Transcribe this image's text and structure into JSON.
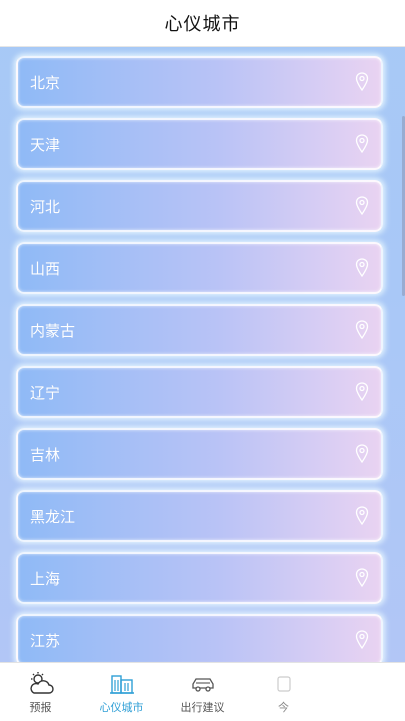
{
  "header": {
    "title": "心仪城市"
  },
  "cities": [
    {
      "label": "北京"
    },
    {
      "label": "天津"
    },
    {
      "label": "河北"
    },
    {
      "label": "山西"
    },
    {
      "label": "内蒙古"
    },
    {
      "label": "辽宁"
    },
    {
      "label": "吉林"
    },
    {
      "label": "黑龙江"
    },
    {
      "label": "上海"
    },
    {
      "label": "江苏"
    }
  ],
  "tabs": [
    {
      "label": "预报",
      "icon": "weather-cloud-sun-icon",
      "active": false
    },
    {
      "label": "心仪城市",
      "icon": "city-buildings-icon",
      "active": true
    },
    {
      "label": "出行建议",
      "icon": "car-icon",
      "active": false
    },
    {
      "label": "今",
      "icon": "unknown-icon",
      "active": false
    }
  ],
  "colors": {
    "accent": "#2f9fd6"
  }
}
